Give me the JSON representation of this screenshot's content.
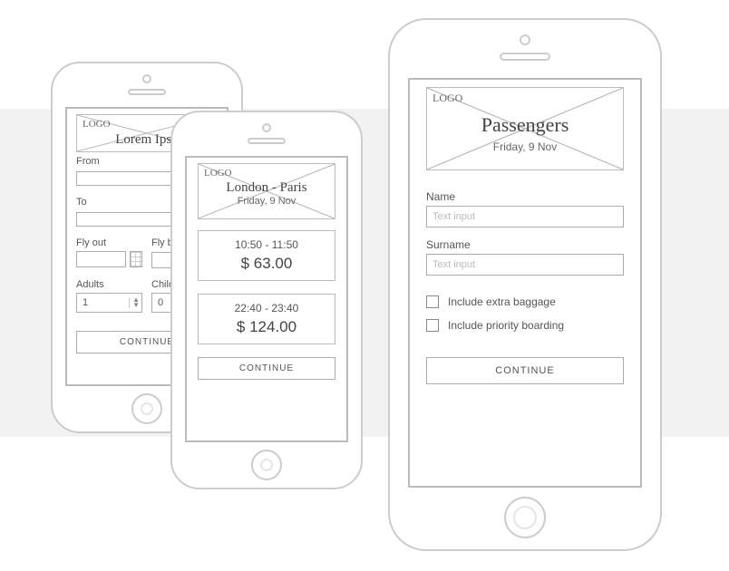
{
  "logo": {
    "text": "LOGO"
  },
  "screen1": {
    "title": "Lorem Ipsu",
    "from_label": "From",
    "to_label": "To",
    "flyout_label": "Fly out",
    "flyback_label": "Fly back",
    "adults_label": "Adults",
    "children_label": "Childre",
    "adults_value": "1",
    "children_value": "0",
    "continue": "CONTINUE"
  },
  "screen2": {
    "title": "London - Paris",
    "date": "Friday, 9 Nov",
    "flights": [
      {
        "time": "10:50 - 11:50",
        "price": "$ 63.00"
      },
      {
        "time": "22:40 - 23:40",
        "price": "$ 124.00"
      }
    ],
    "continue": "CONTINUE"
  },
  "screen3": {
    "title": "Passengers",
    "date": "Friday, 9 Nov",
    "name_label": "Name",
    "surname_label": "Surname",
    "placeholder": "Text input",
    "baggage_label": "Include extra baggage",
    "priority_label": "Include priority boarding",
    "continue": "CONTINUE"
  }
}
